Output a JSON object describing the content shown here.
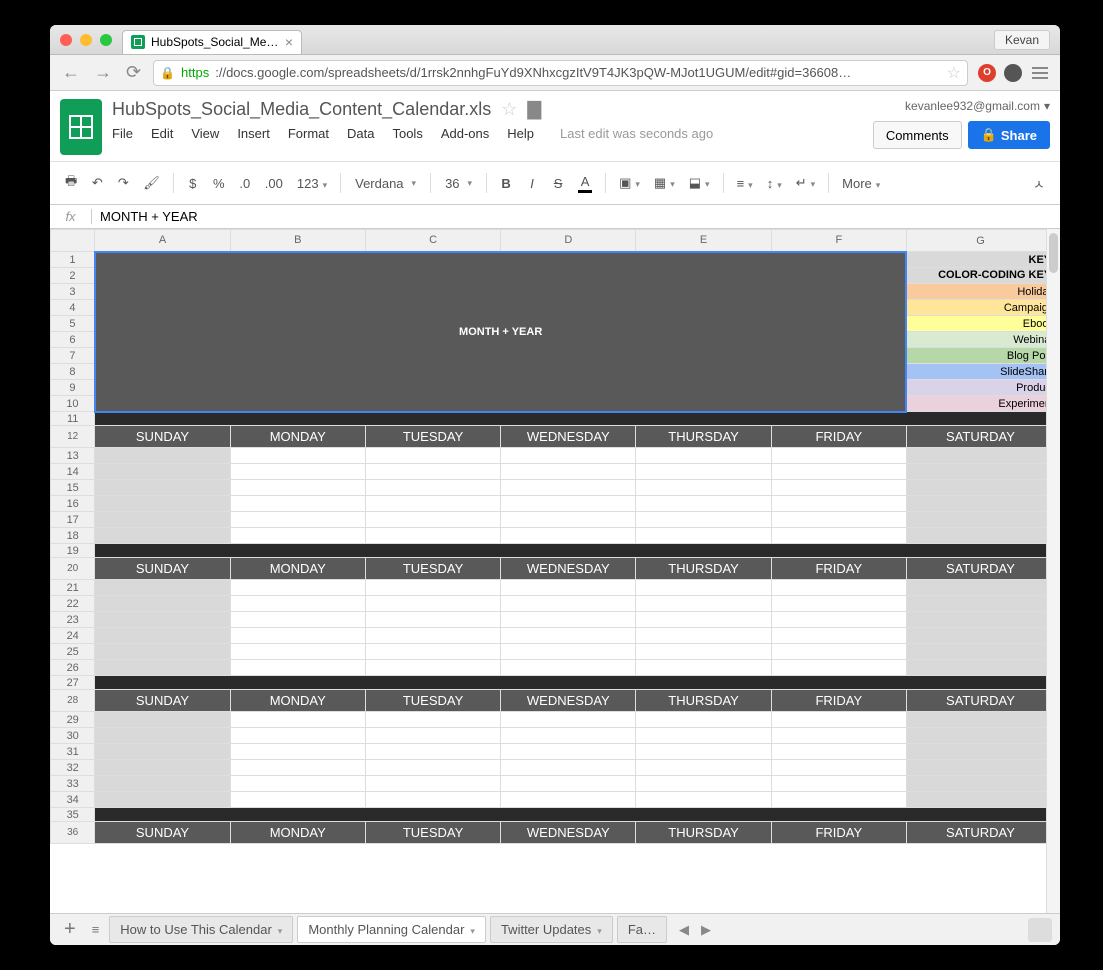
{
  "browser": {
    "tab_title": "HubSpots_Social_Media_C…",
    "user_name": "Kevan",
    "url_https": "https",
    "url_rest": "://docs.google.com/spreadsheets/d/1rrsk2nnhgFuYd9XNhxcgzItV9T4JK3pQW-MJot1UGUM/edit#gid=36608…"
  },
  "doc": {
    "title": "HubSpots_Social_Media_Content_Calendar.xls",
    "email": "kevanlee932@gmail.com",
    "comments_btn": "Comments",
    "share_btn": "Share",
    "last_edit": "Last edit was seconds ago",
    "menu": [
      "File",
      "Edit",
      "View",
      "Insert",
      "Format",
      "Data",
      "Tools",
      "Add-ons",
      "Help"
    ]
  },
  "toolbar": {
    "currency": "$",
    "percent": "%",
    "dec_dec": ".0←",
    "dec_inc": ".00→",
    "numfmt": "123",
    "font": "Verdana",
    "size": "36",
    "more": "More"
  },
  "formula": {
    "fx": "fx",
    "value": "MONTH + YEAR"
  },
  "grid": {
    "columns": [
      "A",
      "B",
      "C",
      "D",
      "E",
      "F",
      "G"
    ],
    "title_cell": "MONTH + YEAR",
    "key_header": "KEY:",
    "key_cc": "COLOR-CODING KEY:",
    "keys": [
      {
        "label": "Holiday",
        "cls": "k-holiday"
      },
      {
        "label": "Campaign",
        "cls": "k-campaign"
      },
      {
        "label": "Ebook",
        "cls": "k-ebook"
      },
      {
        "label": "Webinar",
        "cls": "k-webinar"
      },
      {
        "label": "Blog Post",
        "cls": "k-blog"
      },
      {
        "label": "SlideShare",
        "cls": "k-slide"
      },
      {
        "label": "Product",
        "cls": "k-product"
      },
      {
        "label": "Experiment",
        "cls": "k-exper"
      }
    ],
    "days": [
      "SUNDAY",
      "MONDAY",
      "TUESDAY",
      "WEDNESDAY",
      "THURSDAY",
      "FRIDAY",
      "SATURDAY"
    ]
  },
  "sheet_tabs": {
    "tab1": "How to Use This Calendar",
    "tab2": "Monthly Planning Calendar",
    "tab3": "Twitter Updates",
    "tab4": "Fa…"
  }
}
